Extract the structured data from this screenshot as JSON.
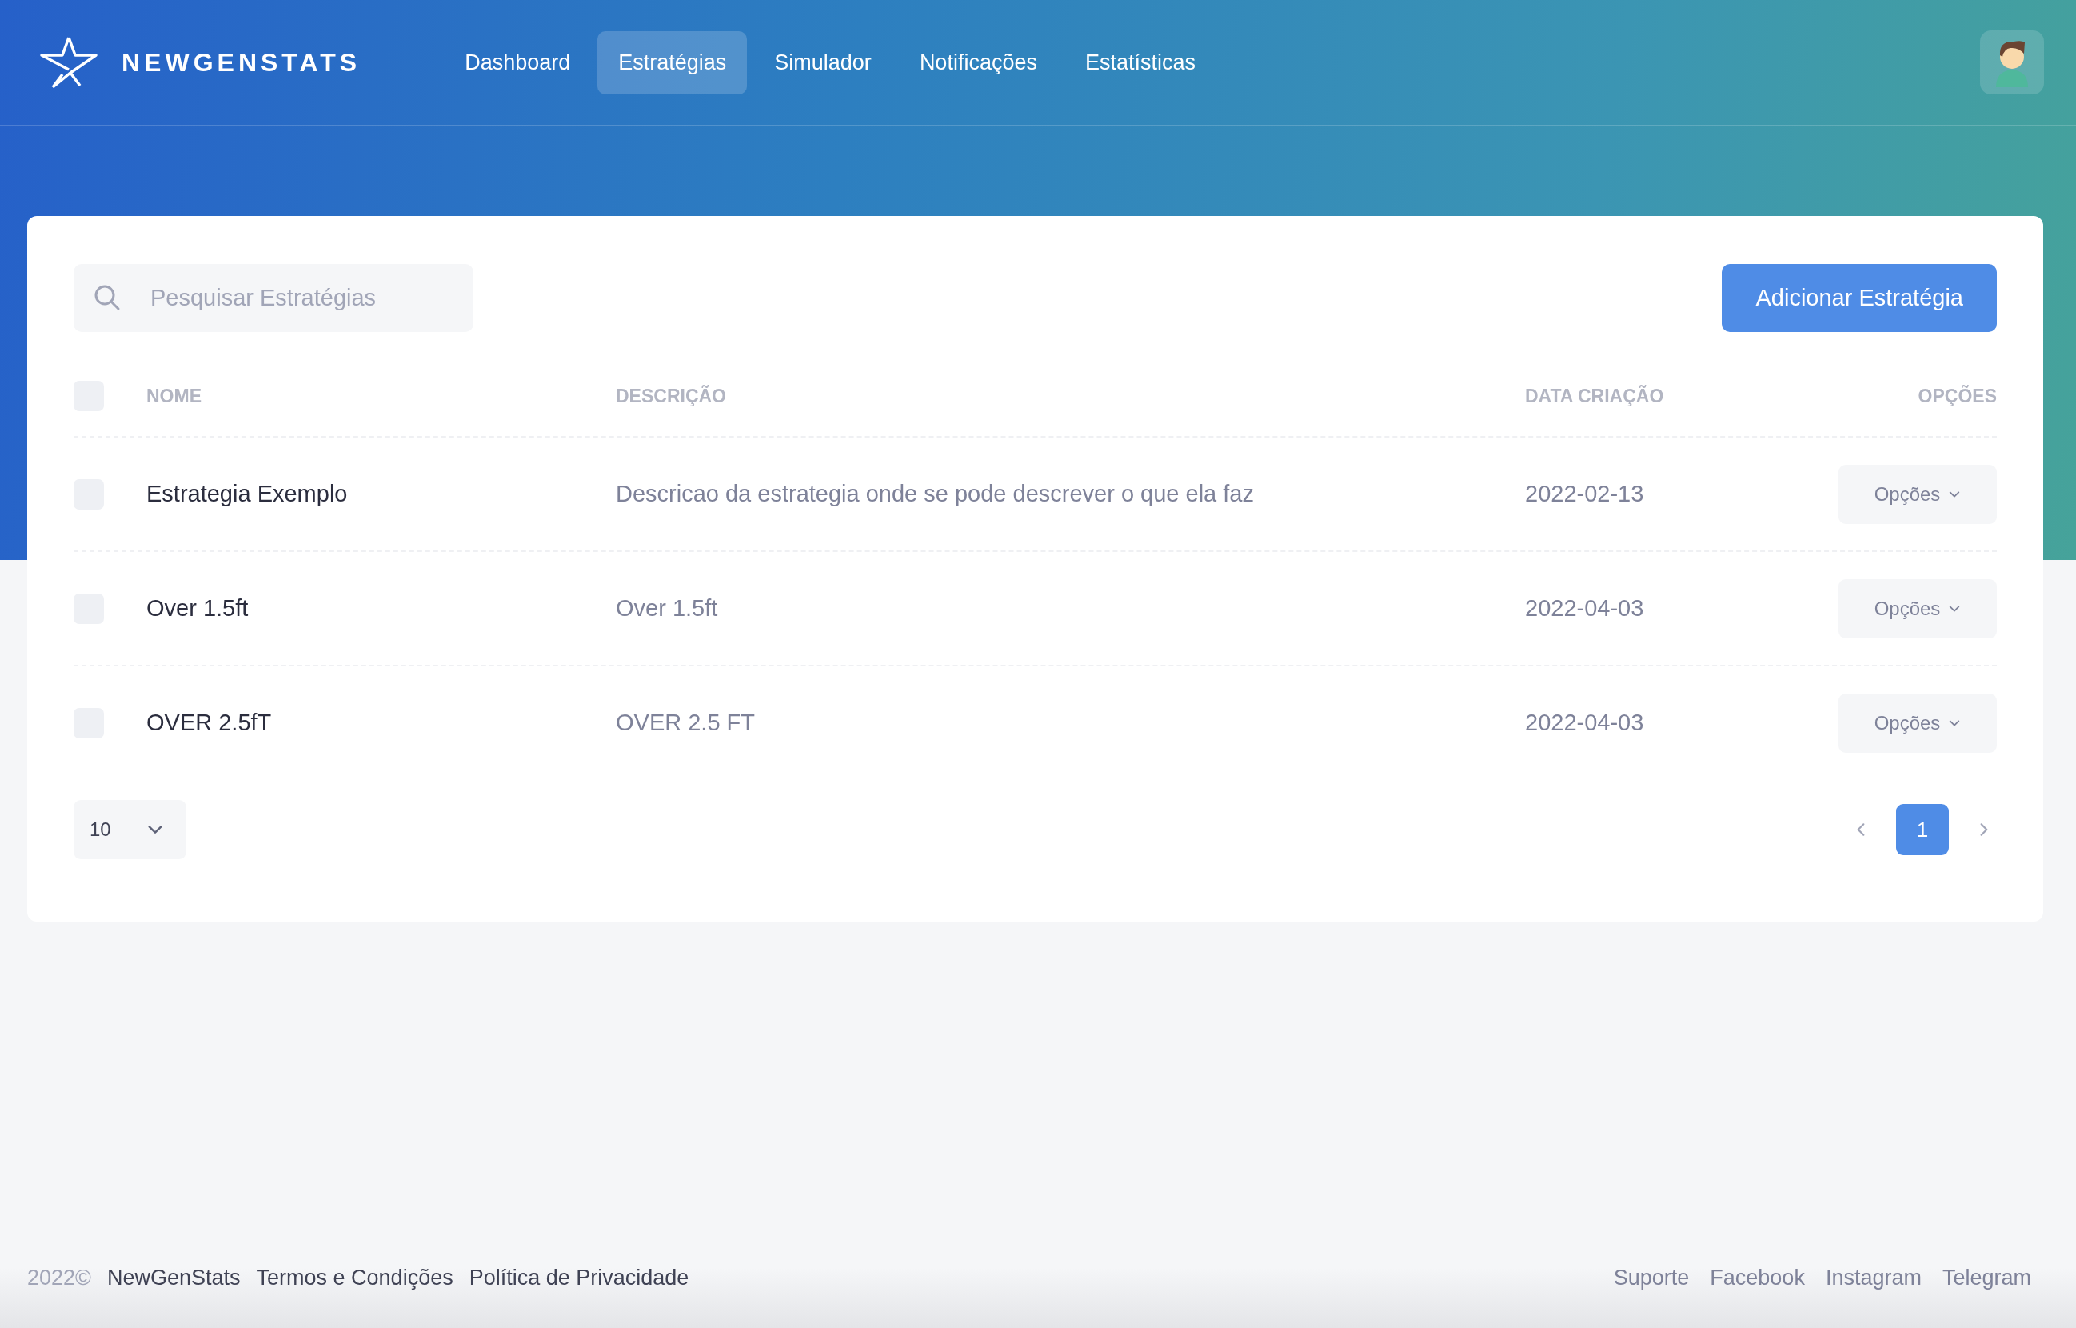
{
  "brand": "NEWGENSTATS",
  "nav": [
    {
      "label": "Dashboard",
      "selected": false
    },
    {
      "label": "Estratégias",
      "selected": true
    },
    {
      "label": "Simulador",
      "selected": false
    },
    {
      "label": "Notificações",
      "selected": false
    },
    {
      "label": "Estatísticas",
      "selected": false
    }
  ],
  "search": {
    "placeholder": "Pesquisar Estratégias"
  },
  "add_button": "Adicionar Estratégia",
  "table": {
    "select_all_checked": false,
    "columns": [
      "NOME",
      "DESCRIÇÃO",
      "DATA CRIAÇÃO",
      "OPÇÕES"
    ],
    "rows": [
      {
        "checked": false,
        "name": "Estrategia Exemplo",
        "description": "Descricao da estrategia onde se pode descrever o que ela faz",
        "date": "2022-02-13",
        "options": "Opções"
      },
      {
        "checked": false,
        "name": "Over 1.5ft",
        "description": "Over 1.5ft",
        "date": "2022-04-03",
        "options": "Opções"
      },
      {
        "checked": false,
        "name": "OVER 2.5fT",
        "description": "OVER 2.5 FT",
        "date": "2022-04-03",
        "options": "Opções"
      }
    ]
  },
  "page_size": "10",
  "pages": [
    {
      "label": "1",
      "selected": true
    }
  ],
  "footer": {
    "year": "2022©",
    "brand": "NewGenStats",
    "left_links": [
      "Termos e Condições",
      "Política de Privacidade"
    ],
    "right_links": [
      "Suporte",
      "Facebook",
      "Instagram",
      "Telegram"
    ]
  }
}
